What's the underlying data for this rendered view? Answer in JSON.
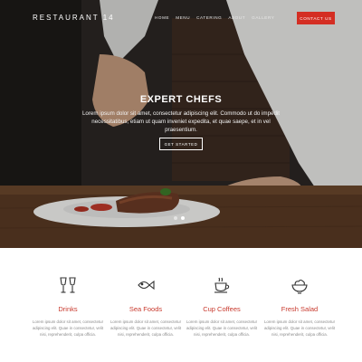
{
  "header": {
    "brand": "RESTAURANT 14",
    "menu": [
      "HOME",
      "MENU",
      "CATERING",
      "ABOUT",
      "GALLERY"
    ],
    "contact_label": "CONTACT US"
  },
  "hero": {
    "title": "EXPERT CHEFS",
    "text": "Lorem ipsum dolor sit amet, consectetur adipiscing elit. Commodo ut do impedit necessitatibus, etiam ut quam inveniet expedita, et quae saepe, et in vel praesentium.",
    "button_label": "GET STARTED",
    "slides": 2,
    "active_slide": 1
  },
  "features": [
    {
      "title": "Drinks",
      "icon": "wine-glasses-icon",
      "text": "Lorem ipsum dolor sit amet, consectetur adipiscing elit. Quae in consectetur, velit nisi, reprehenderit, culpa officia."
    },
    {
      "title": "Sea Foods",
      "icon": "fish-icon",
      "text": "Lorem ipsum dolor sit amet, consectetur adipiscing elit. Quae in consectetur, velit nisi, reprehenderit, culpa officia."
    },
    {
      "title": "Cup Coffees",
      "icon": "coffee-cup-icon",
      "text": "Lorem ipsum dolor sit amet, consectetur adipiscing elit. Quae in consectetur, velit nisi, reprehenderit, culpa officia."
    },
    {
      "title": "Fresh Salad",
      "icon": "salad-bowl-icon",
      "text": "Lorem ipsum dolor sit amet, consectetur adipiscing elit. Quae in consectetur, velit nisi, reprehenderit, culpa officia."
    }
  ],
  "colors": {
    "accent": "#d42e23",
    "feature_title": "#c8392d",
    "body_text": "#8a8a8a"
  }
}
